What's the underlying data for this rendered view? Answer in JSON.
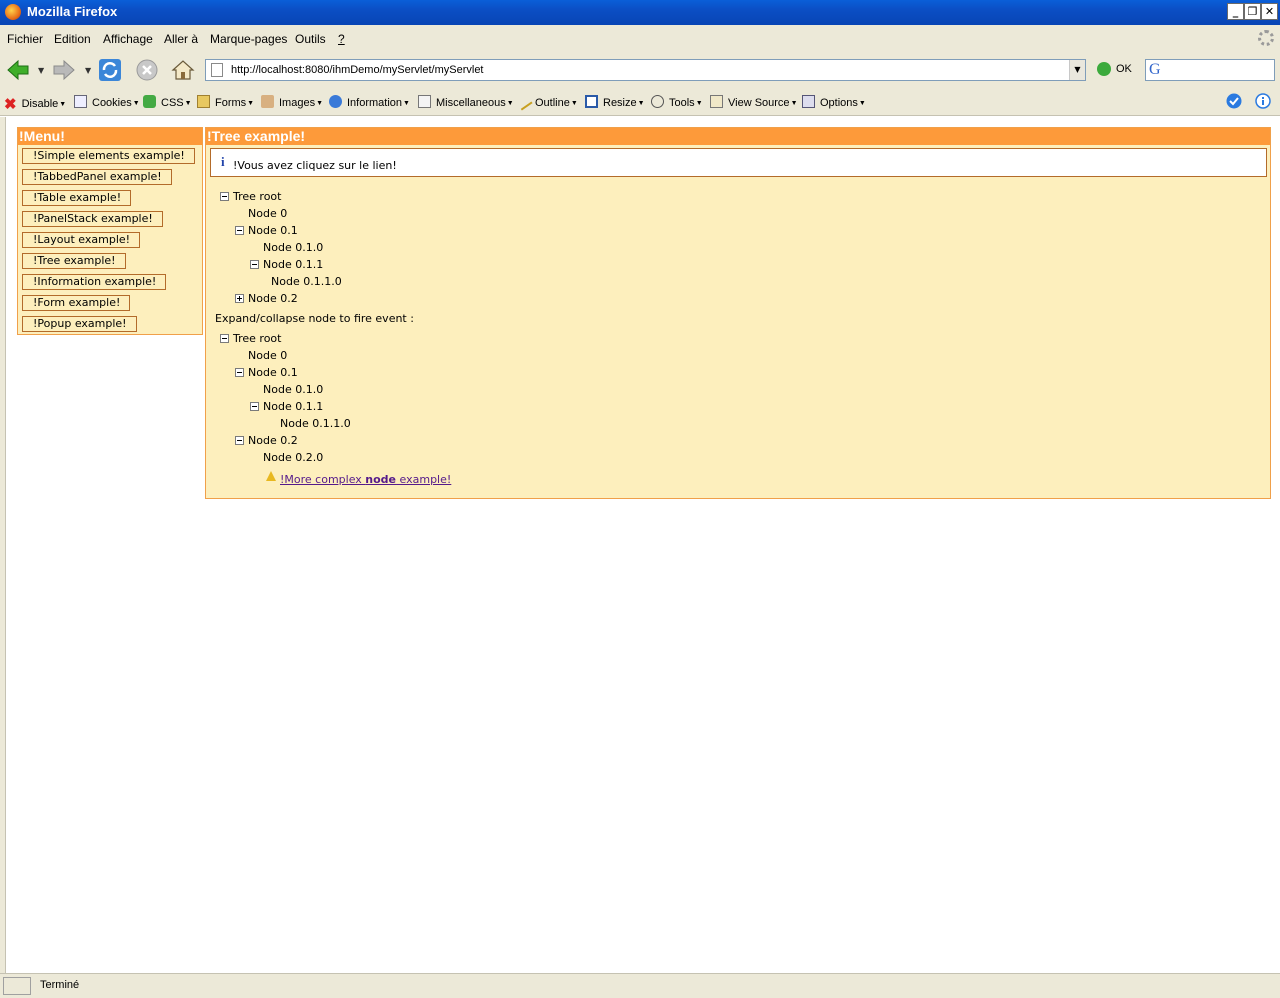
{
  "window": {
    "title": "Mozilla Firefox"
  },
  "menubar": {
    "items": [
      "Fichier",
      "Edition",
      "Affichage",
      "Aller à",
      "Marque-pages",
      "Outils",
      "?"
    ]
  },
  "navbar": {
    "url": "http://localhost:8080/ihmDemo/myServlet/myServlet",
    "go_label": "OK",
    "search_engine_glyph": "G"
  },
  "devbar": {
    "items": [
      "Disable",
      "Cookies",
      "CSS",
      "Forms",
      "Images",
      "Information",
      "Miscellaneous",
      "Outline",
      "Resize",
      "Tools",
      "View Source",
      "Options"
    ]
  },
  "menu_panel": {
    "title": "!Menu!",
    "buttons": [
      "!Simple elements example!",
      "!TabbedPanel example!",
      "!Table example!",
      "!PanelStack example!",
      "!Layout example!",
      "!Tree example!",
      "!Information example!",
      "!Form example!",
      "!Popup example!"
    ]
  },
  "tree_panel": {
    "title": "!Tree example!",
    "info_message": "!Vous avez cliquez sur le lien!",
    "tree1": {
      "root": "Tree root",
      "n0": "Node 0",
      "n01": "Node 0.1",
      "n010": "Node 0.1.0",
      "n011": "Node 0.1.1",
      "n0110": "Node 0.1.1.0",
      "n02": "Node 0.2"
    },
    "event_label": "Expand/collapse node to fire event :",
    "tree2": {
      "root": "Tree root",
      "n0": "Node 0",
      "n01": "Node 0.1",
      "n010": "Node 0.1.0",
      "n011": "Node 0.1.1",
      "n0110": "Node 0.1.1.0",
      "n02": "Node 0.2",
      "n020": "Node 0.2.0"
    },
    "complex_link": {
      "prefix": "!More complex ",
      "bold": "node",
      "suffix": " example!"
    }
  },
  "statusbar": {
    "text": "Terminé"
  },
  "colors": {
    "panel_header": "#fd9a3a",
    "panel_bg": "#fdefbd",
    "titlebar": "#0b4ec4"
  }
}
